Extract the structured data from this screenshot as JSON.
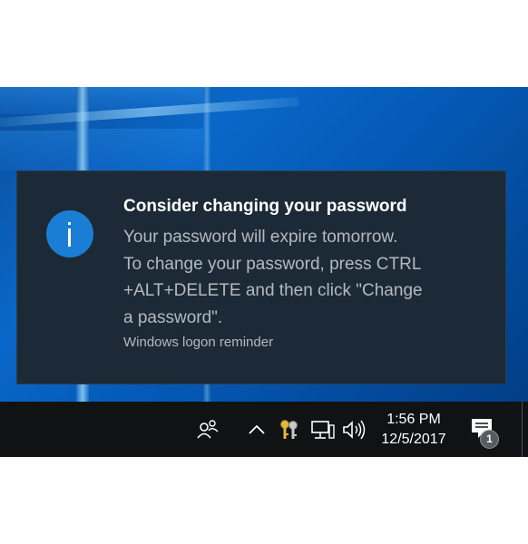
{
  "notification": {
    "title": "Consider changing your password",
    "body_lines": [
      "Your password will expire tomorrow.",
      "To change your password, press CTRL",
      "+ALT+DELETE and then click \"Change",
      "a password\"."
    ],
    "source": "Windows logon reminder",
    "icon": "info-icon",
    "icon_color": "#1a7fd4",
    "background_color": "#1c2a37"
  },
  "taskbar": {
    "icons": [
      "people-icon",
      "chevron-up-icon",
      "keys-icon",
      "network-icon",
      "volume-icon"
    ],
    "time": "1:56 PM",
    "date": "12/5/2017",
    "action_center": {
      "icon": "action-center-icon",
      "badge_count": "1"
    },
    "background_color": "#101214"
  },
  "desktop": {
    "accent_color": "#0a67c8"
  }
}
